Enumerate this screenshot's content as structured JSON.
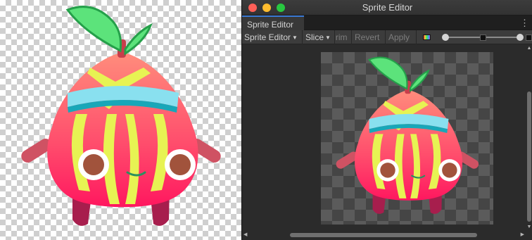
{
  "window": {
    "title": "Sprite Editor"
  },
  "tabs": [
    {
      "label": "Sprite Editor"
    }
  ],
  "toolbar": {
    "sprite_editor_label": "Sprite Editor",
    "slice_label": "Slice",
    "trim_label": "Trim",
    "revert_label": "Revert",
    "apply_label": "Apply",
    "zoom_level": 0.93
  },
  "icons": {
    "close": "traffic-close-icon",
    "minimize": "traffic-minimize-icon",
    "maximize": "traffic-maximize-icon",
    "tab_menu": "kebab-menu-icon",
    "color_channels": "rgb-channels-icon",
    "mipmap_small": "small-checker-icon",
    "mipmap_large": "large-checker-icon"
  },
  "colors": {
    "accent": "#3a79d3",
    "character_top": "#ff8a7a",
    "character_bottom": "#ff1c60",
    "stripe": "#e7f353",
    "band": "#89e0ef",
    "leaf": "#5ce37b"
  }
}
